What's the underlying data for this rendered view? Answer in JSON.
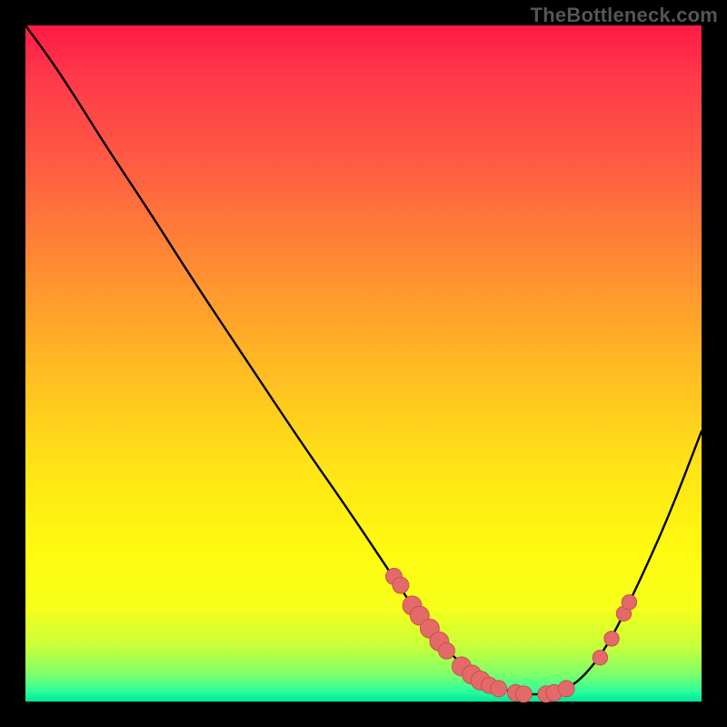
{
  "watermark": "TheBottleneck.com",
  "colors": {
    "bead_fill": "#e46a6a",
    "bead_stroke": "#c94f4f",
    "curve": "#000000"
  },
  "chart_data": {
    "type": "line",
    "title": "",
    "xlabel": "",
    "ylabel": "",
    "xlim": [
      0,
      100
    ],
    "ylim": [
      0,
      100
    ],
    "grid": false,
    "legend": false,
    "series": [
      {
        "name": "bottleneck-curve",
        "x": [
          0,
          3,
          7,
          12,
          18,
          25,
          33,
          41,
          48,
          54,
          58,
          61,
          64,
          67,
          70,
          73,
          76,
          79,
          82,
          86,
          90,
          95,
          100
        ],
        "y": [
          100,
          96,
          90,
          82,
          73,
          62,
          50,
          38,
          28,
          19,
          13,
          9,
          6,
          3.5,
          2,
          1.2,
          1,
          1.5,
          3,
          8,
          16,
          27,
          40
        ]
      }
    ],
    "markers": [
      {
        "x": 54.5,
        "y": 18.5,
        "r": 1.2
      },
      {
        "x": 55.5,
        "y": 17.2,
        "r": 1.2
      },
      {
        "x": 57.2,
        "y": 14.2,
        "r": 1.4
      },
      {
        "x": 58.3,
        "y": 12.7,
        "r": 1.4
      },
      {
        "x": 59.8,
        "y": 10.8,
        "r": 1.4
      },
      {
        "x": 61.2,
        "y": 8.9,
        "r": 1.4
      },
      {
        "x": 62.3,
        "y": 7.5,
        "r": 1.2
      },
      {
        "x": 64.5,
        "y": 5.2,
        "r": 1.4
      },
      {
        "x": 66.0,
        "y": 4.0,
        "r": 1.4
      },
      {
        "x": 67.3,
        "y": 3.1,
        "r": 1.4
      },
      {
        "x": 68.6,
        "y": 2.4,
        "r": 1.2
      },
      {
        "x": 70.0,
        "y": 1.9,
        "r": 1.2
      },
      {
        "x": 72.5,
        "y": 1.3,
        "r": 1.2
      },
      {
        "x": 73.7,
        "y": 1.1,
        "r": 1.2
      },
      {
        "x": 77.0,
        "y": 1.1,
        "r": 1.2
      },
      {
        "x": 78.2,
        "y": 1.3,
        "r": 1.2
      },
      {
        "x": 80.0,
        "y": 1.9,
        "r": 1.2
      },
      {
        "x": 85.0,
        "y": 6.5,
        "r": 1.1
      },
      {
        "x": 86.7,
        "y": 9.3,
        "r": 1.1
      },
      {
        "x": 88.5,
        "y": 13.0,
        "r": 1.1
      },
      {
        "x": 89.3,
        "y": 14.7,
        "r": 1.1
      }
    ]
  }
}
